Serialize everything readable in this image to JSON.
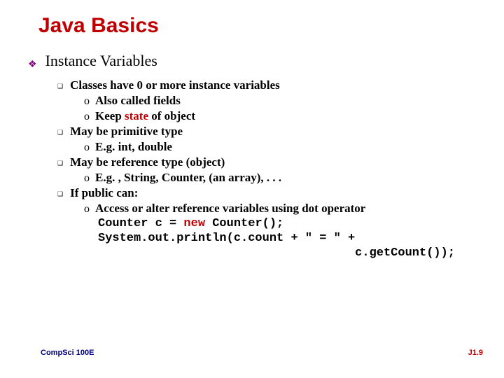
{
  "title": "Java Basics",
  "h1": "Instance Variables",
  "i1": "Classes have 0 or more instance variables",
  "i1a": "Also called fields",
  "i1b_pre": "Keep ",
  "i1b_red": "state",
  "i1b_post": " of object",
  "i2": "May be primitive type",
  "i2a": "E.g. int, double",
  "i3": "May be reference type (object)",
  "i3a": "E.g. , String, Counter, (an array), . . .",
  "i4": "If public can:",
  "i4a": "Access or alter reference  variables using dot operator",
  "code1_a": "Counter c = ",
  "code1_new": "new",
  "code1_b": " Counter();",
  "code2": "System.out.println(c.count + \" = \" + ",
  "code3": "c.getCount());",
  "footer_left": "CompSci 100E",
  "footer_right": "J1.9",
  "bullets": {
    "diamond": "❖",
    "square": "❑",
    "circle": "o"
  }
}
